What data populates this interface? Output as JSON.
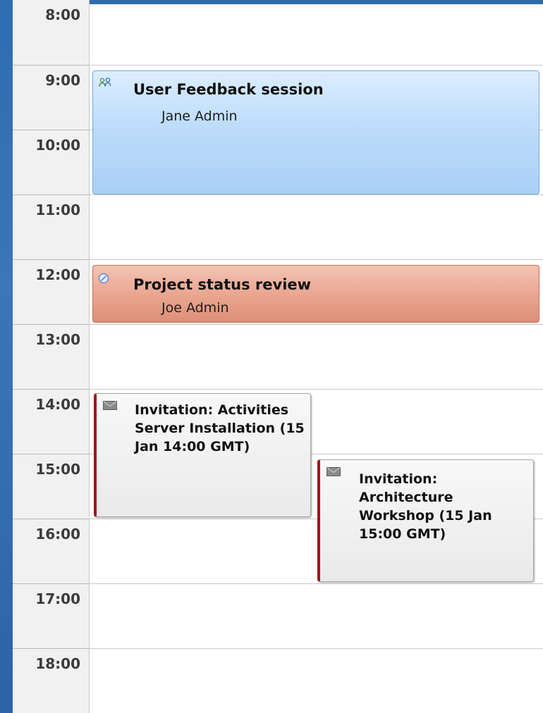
{
  "hours": [
    "8:00",
    "9:00",
    "10:00",
    "11:00",
    "12:00",
    "13:00",
    "14:00",
    "15:00",
    "16:00",
    "17:00",
    "18:00"
  ],
  "events": {
    "feedback": {
      "title": "User Feedback session",
      "organizer": "Jane Admin",
      "icon": "people-icon",
      "color": "#bcdcfb"
    },
    "status_review": {
      "title": "Project status review",
      "organizer": "Joe Admin",
      "icon": "status-icon",
      "color": "#e9a48e"
    },
    "invite_install": {
      "title": "Invitation: Activities Server Installation (15 Jan 14:00 GMT)",
      "icon": "envelope-icon",
      "color": "#efefef"
    },
    "invite_workshop": {
      "title": "Invitation: Architecture Workshop (15 Jan 15:00 GMT)",
      "icon": "envelope-icon",
      "color": "#efefef"
    }
  },
  "accent": "#2f6db0",
  "invitation_marker": "#a0161b"
}
